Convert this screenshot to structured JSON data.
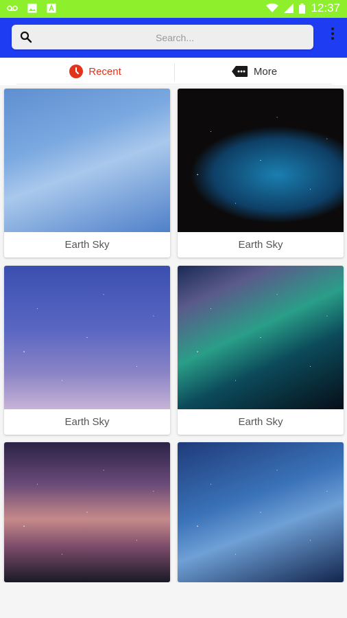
{
  "status_bar": {
    "time": "12:37",
    "icons": [
      "voicemail-icon",
      "image-icon",
      "text-icon"
    ],
    "right_icons": [
      "wifi-icon",
      "signal-icon",
      "battery-icon"
    ],
    "background": "#8ef02c"
  },
  "app_bar": {
    "background": "#1e3cf2",
    "search": {
      "placeholder": "Search..."
    },
    "overflow_icon": "more-vert-icon"
  },
  "tabs": [
    {
      "label": "Recent",
      "icon": "clock-icon",
      "active": true,
      "color": "#e2331b"
    },
    {
      "label": "More",
      "icon": "label-more-icon",
      "active": false
    }
  ],
  "grid": {
    "items": [
      {
        "caption": "Earth Sky",
        "image": "blue-sky-clouds"
      },
      {
        "caption": "Earth Sky",
        "image": "cave-night-sky"
      },
      {
        "caption": "Earth Sky",
        "image": "purple-dusk-sky"
      },
      {
        "caption": "Earth Sky",
        "image": "milky-way-aurora"
      },
      {
        "caption": "",
        "image": "sunset-mountains"
      },
      {
        "caption": "",
        "image": "starry-night-trees"
      }
    ]
  }
}
